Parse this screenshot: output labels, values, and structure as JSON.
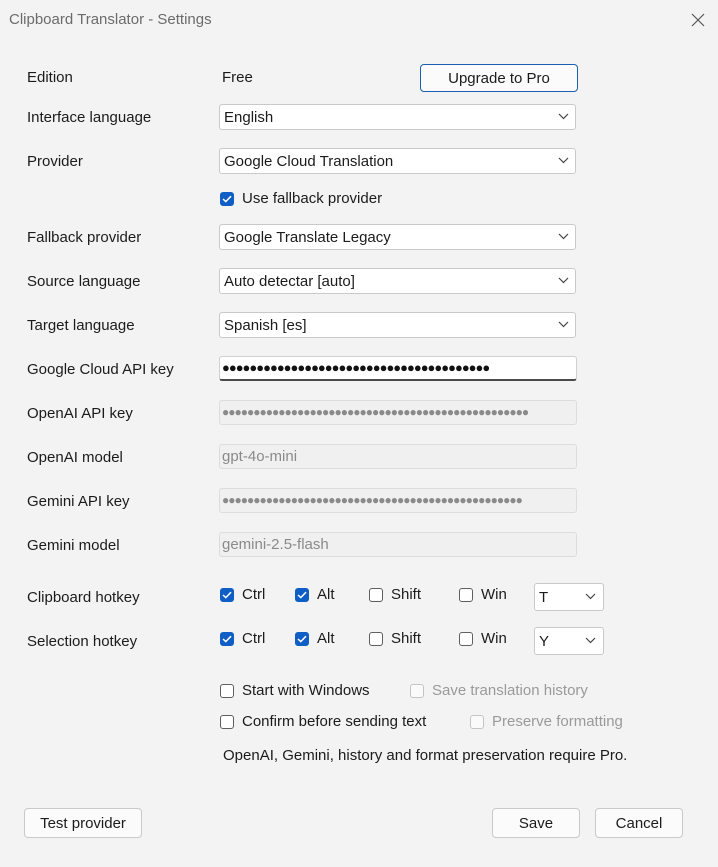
{
  "window": {
    "title": "Clipboard Translator - Settings"
  },
  "edition": {
    "label": "Edition",
    "value": "Free",
    "upgrade_label": "Upgrade to Pro"
  },
  "interface_language": {
    "label": "Interface language",
    "value": "English"
  },
  "provider": {
    "label": "Provider",
    "value": "Google Cloud Translation"
  },
  "use_fallback": {
    "label": "Use fallback provider",
    "checked": true
  },
  "fallback_provider": {
    "label": "Fallback provider",
    "value": "Google Translate Legacy"
  },
  "source_language": {
    "label": "Source language",
    "value": "Auto detectar [auto]"
  },
  "target_language": {
    "label": "Target language",
    "value": "Spanish [es]"
  },
  "google_api_key": {
    "label": "Google Cloud API key",
    "value": "●●●●●●●●●●●●●●●●●●●●●●●●●●●●●●●●●●●●●●●"
  },
  "openai_api_key": {
    "label": "OpenAI API key",
    "value": "●●●●●●●●●●●●●●●●●●●●●●●●●●●●●●●●●●●●●●●●●●●●●●●●●"
  },
  "openai_model": {
    "label": "OpenAI model",
    "value": "gpt-4o-mini"
  },
  "gemini_api_key": {
    "label": "Gemini API key",
    "value": "●●●●●●●●●●●●●●●●●●●●●●●●●●●●●●●●●●●●●●●●●●●●●●●●"
  },
  "gemini_model": {
    "label": "Gemini model",
    "value": "gemini-2.5-flash"
  },
  "clipboard_hotkey": {
    "label": "Clipboard hotkey",
    "ctrl": "Ctrl",
    "alt": "Alt",
    "shift": "Shift",
    "win": "Win",
    "key": "T"
  },
  "selection_hotkey": {
    "label": "Selection hotkey",
    "ctrl": "Ctrl",
    "alt": "Alt",
    "shift": "Shift",
    "win": "Win",
    "key": "Y"
  },
  "options": {
    "start_with_windows": "Start with Windows",
    "save_history": "Save translation history",
    "confirm_before_sending": "Confirm before sending text",
    "preserve_formatting": "Preserve formatting"
  },
  "pro_note": "OpenAI, Gemini, history and format preservation require Pro.",
  "buttons": {
    "test_provider": "Test provider",
    "save": "Save",
    "cancel": "Cancel"
  },
  "colors": {
    "accent": "#0f5ec6",
    "background": "#f3f3f3"
  }
}
